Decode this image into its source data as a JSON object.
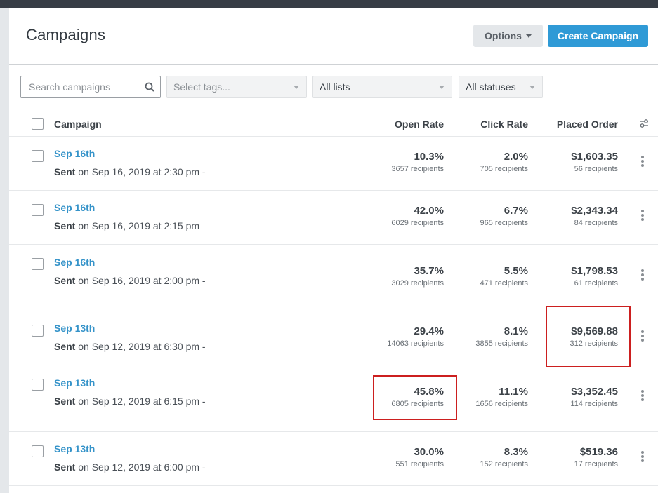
{
  "header": {
    "title": "Campaigns",
    "options_label": "Options",
    "create_label": "Create Campaign"
  },
  "filters": {
    "search_placeholder": "Search campaigns",
    "tags_placeholder": "Select tags...",
    "lists_value": "All lists",
    "status_value": "All statuses"
  },
  "colors": {
    "accent": "#2f9ad6",
    "link": "#3593c9",
    "highlight": "#cc1f1f",
    "topbar": "#373d45"
  },
  "table": {
    "columns": {
      "campaign": "Campaign",
      "open_rate": "Open Rate",
      "click_rate": "Click Rate",
      "placed_order": "Placed Order"
    },
    "rows": [
      {
        "name": "Sep 16th",
        "sent_prefix": "Sent",
        "sent_text": "on Sep 16, 2019 at 2:30 pm -",
        "open_rate": "10.3%",
        "open_recipients": "3657 recipients",
        "click_rate": "2.0%",
        "click_recipients": "705 recipients",
        "placed_order": "$1,603.35",
        "placed_recipients": "56 recipients"
      },
      {
        "name": "Sep 16th",
        "sent_prefix": "Sent",
        "sent_text": "on Sep 16, 2019 at 2:15 pm",
        "open_rate": "42.0%",
        "open_recipients": "6029 recipients",
        "click_rate": "6.7%",
        "click_recipients": "965 recipients",
        "placed_order": "$2,343.34",
        "placed_recipients": "84 recipients"
      },
      {
        "name": "Sep 16th",
        "sent_prefix": "Sent",
        "sent_text": "on Sep 16, 2019 at 2:00 pm -",
        "open_rate": "35.7%",
        "open_recipients": "3029 recipients",
        "click_rate": "5.5%",
        "click_recipients": "471 recipients",
        "placed_order": "$1,798.53",
        "placed_recipients": "61 recipients"
      },
      {
        "name": "Sep 13th",
        "sent_prefix": "Sent",
        "sent_text": "on Sep 12, 2019 at 6:30 pm -",
        "open_rate": "29.4%",
        "open_recipients": "14063 recipients",
        "click_rate": "8.1%",
        "click_recipients": "3855 recipients",
        "placed_order": "$9,569.88",
        "placed_recipients": "312 recipients"
      },
      {
        "name": "Sep 13th",
        "sent_prefix": "Sent",
        "sent_text": "on Sep 12, 2019 at 6:15 pm -",
        "open_rate": "45.8%",
        "open_recipients": "6805 recipients",
        "click_rate": "11.1%",
        "click_recipients": "1656 recipients",
        "placed_order": "$3,352.45",
        "placed_recipients": "114 recipients"
      },
      {
        "name": "Sep 13th",
        "sent_prefix": "Sent",
        "sent_text": "on Sep 12, 2019 at 6:00 pm -",
        "open_rate": "30.0%",
        "open_recipients": "551 recipients",
        "click_rate": "8.3%",
        "click_recipients": "152 recipients",
        "placed_order": "$519.36",
        "placed_recipients": "17 recipients"
      }
    ]
  }
}
